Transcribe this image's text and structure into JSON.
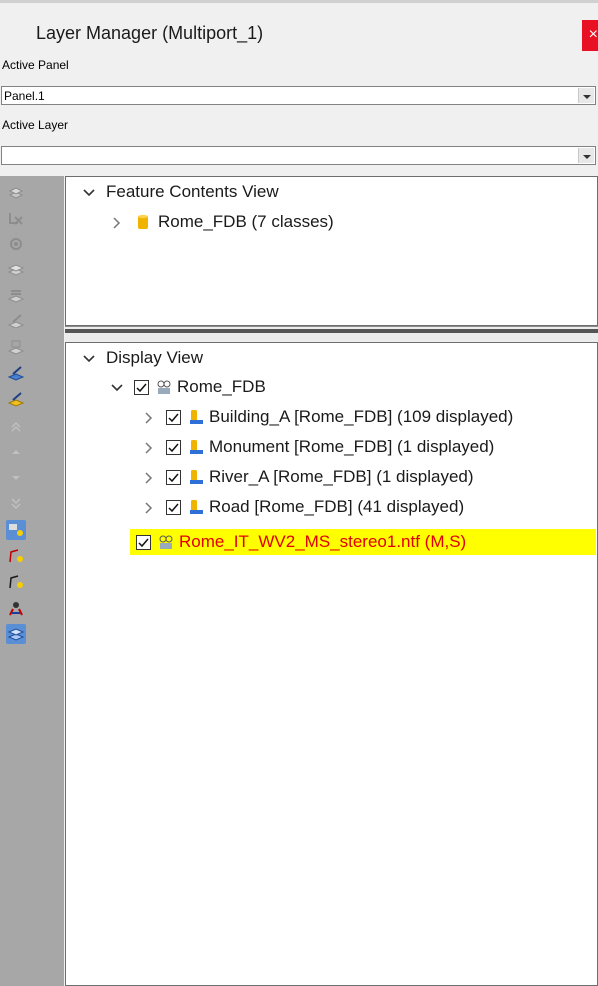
{
  "window": {
    "title": "Layer Manager (Multiport_1)",
    "close_label": "×"
  },
  "active_panel": {
    "label": "Active Panel",
    "value": "Panel.1"
  },
  "active_layer": {
    "label": "Active Layer",
    "value": ""
  },
  "feature_contents": {
    "header": "Feature Contents View",
    "items": [
      {
        "label": "Rome_FDB  (7 classes)",
        "icon": "database-icon"
      }
    ]
  },
  "display_view": {
    "header": "Display View",
    "root": {
      "label": "Rome_FDB",
      "checked": true,
      "icon": "layer-group-icon"
    },
    "children": [
      {
        "label": "Building_A [Rome_FDB]  (109 displayed)",
        "checked": true,
        "icon": "feature-class-icon"
      },
      {
        "label": "Monument [Rome_FDB]  (1 displayed)",
        "checked": true,
        "icon": "feature-class-icon"
      },
      {
        "label": "River_A [Rome_FDB]  (1 displayed)",
        "checked": true,
        "icon": "feature-class-icon"
      },
      {
        "label": "Road [Rome_FDB]  (41 displayed)",
        "checked": true,
        "icon": "feature-class-icon"
      }
    ],
    "image_layer": {
      "label": "Rome_IT_WV2_MS_stereo1.ntf (M,S)",
      "checked": true,
      "icon": "image-layer-icon",
      "highlight_color": "#ffff00",
      "text_color": "#e00000"
    }
  },
  "toolbar": {
    "tools": [
      "add-layer-icon",
      "remove-layer-icon",
      "layer-properties-icon",
      "stack-icon",
      "stack-edit-icon",
      "stack-pen-icon",
      "stack-grid-icon",
      "stack-blue-pen-icon",
      "stack-yellow-pen-icon",
      "move-top-icon",
      "move-up-icon",
      "move-down-icon",
      "move-bottom-icon",
      "select-vertex-icon",
      "vertex-edit-icon",
      "vertex-add-icon",
      "rotate-tool-icon",
      "layers-active-icon"
    ]
  },
  "colors": {
    "toolbar_bg": "#a7a7a7",
    "close_red": "#e81123"
  }
}
